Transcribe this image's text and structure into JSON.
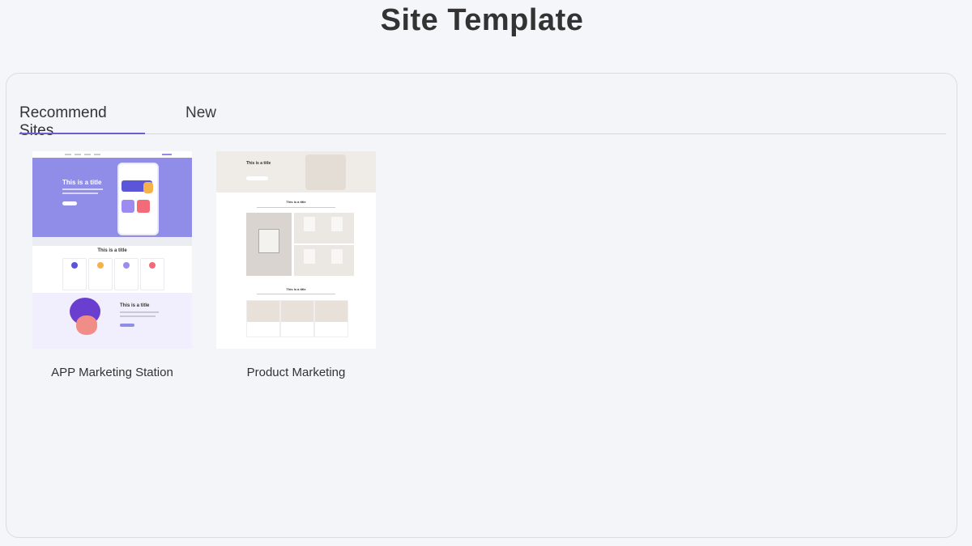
{
  "header": {
    "title": "Site Template"
  },
  "tabs": [
    {
      "label": "Recommend Sites",
      "active": true
    },
    {
      "label": "New",
      "active": false
    }
  ],
  "templates": [
    {
      "label": "APP Marketing Station",
      "thumbnail": {
        "hero_title": "This is a title",
        "section_title": "This is a title",
        "feature_title": "This is a title"
      }
    },
    {
      "label": "Product Marketing",
      "thumbnail": {
        "hero_title": "This is a title",
        "section_title": "This is a title",
        "section2_title": "This is a title"
      }
    }
  ],
  "colors": {
    "accent": "#6a5fd0",
    "hero_purple": "#8f8de8"
  }
}
